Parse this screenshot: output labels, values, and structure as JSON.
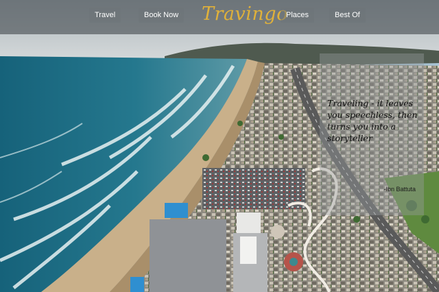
{
  "navbar": {
    "left_items": [
      {
        "label": "Travel"
      },
      {
        "label": "Book Now"
      }
    ],
    "logo": "Travingo",
    "right_items": [
      {
        "label": "Places"
      },
      {
        "label": "Best Of"
      }
    ]
  },
  "hero": {
    "quote": "Traveling - it leaves you speechless, then turns you into a storyteller",
    "author": "-Ibn Battuta"
  },
  "colors": {
    "logo": "#e0b13a",
    "nav_bar": "#464c50",
    "ocean": "#1f6f86",
    "sand": "#c9b08a"
  }
}
